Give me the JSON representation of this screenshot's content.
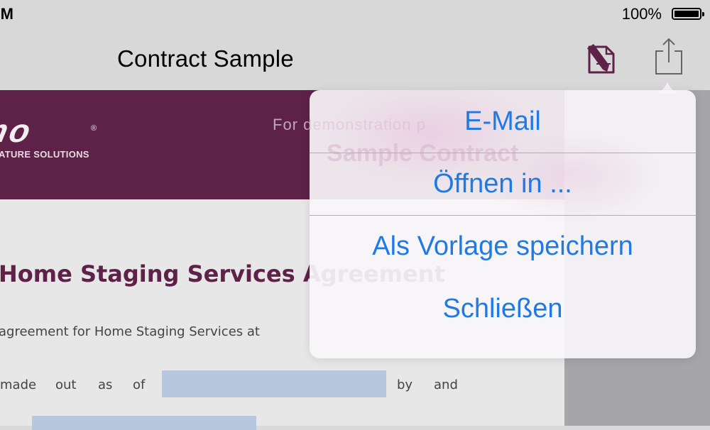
{
  "status_bar": {
    "time": "PM",
    "battery": "100%"
  },
  "nav": {
    "title": "Contract Sample",
    "edit_icon": "edit-document-icon",
    "share_icon": "share-icon"
  },
  "document": {
    "header": {
      "logo": "mo",
      "logo_registered": "®",
      "logo_subtitle": "ATURE SOLUTIONS",
      "note": "For demonstration p",
      "title_fragment": "Sample Contract"
    },
    "title": "Home Staging Services Agreement",
    "line1": "agreement for Home Staging Services at",
    "line2": {
      "w1": "made",
      "w2": "out",
      "w3": "as",
      "w4": "of",
      "w5": "by",
      "w6": "and"
    }
  },
  "popover": {
    "items": [
      "E-Mail",
      "Öffnen in ...",
      "Als Vorlage speichern",
      "Schließen"
    ]
  },
  "colors": {
    "accent": "#1f7ae6",
    "brand": "#5e2248",
    "field": "#b7c7dd"
  }
}
